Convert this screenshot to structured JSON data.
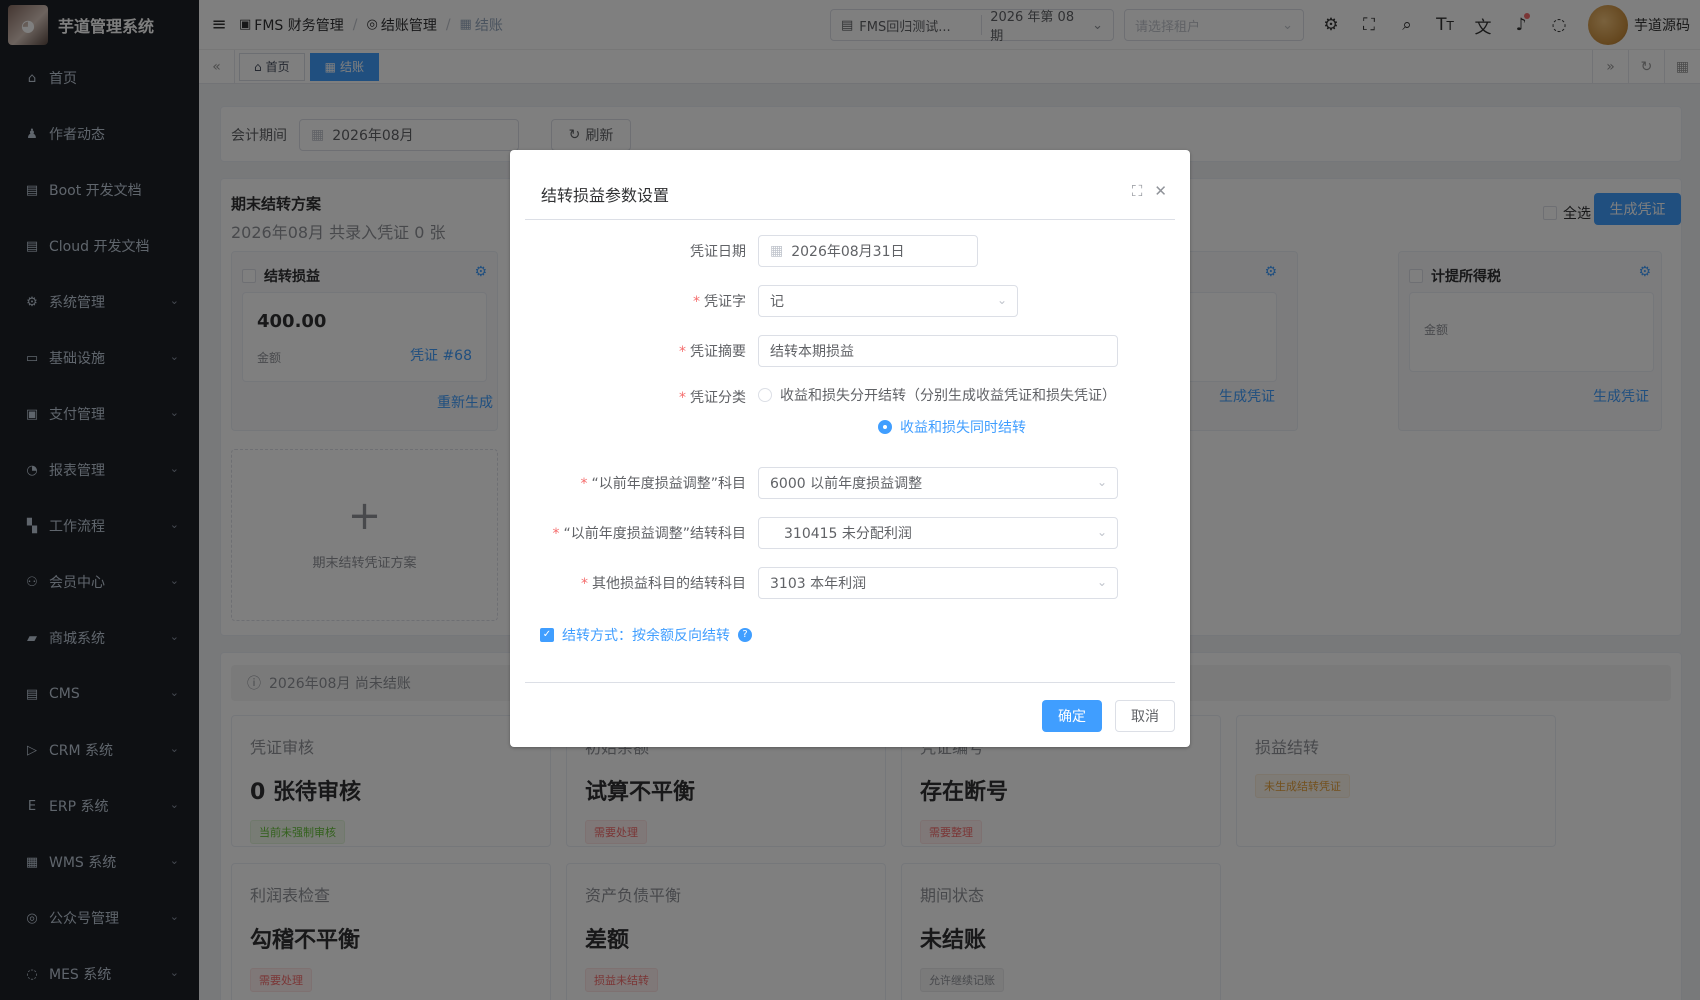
{
  "app": {
    "title": "芋道管理系统"
  },
  "sidebar": {
    "items": [
      {
        "label": "首页",
        "icon": "home-icon",
        "has_children": false
      },
      {
        "label": "作者动态",
        "icon": "user-icon",
        "has_children": false
      },
      {
        "label": "Boot 开发文档",
        "icon": "doc-icon",
        "has_children": false
      },
      {
        "label": "Cloud 开发文档",
        "icon": "doc-icon",
        "has_children": false
      },
      {
        "label": "系统管理",
        "icon": "gear-icon",
        "has_children": true
      },
      {
        "label": "基础设施",
        "icon": "monitor-icon",
        "has_children": true
      },
      {
        "label": "支付管理",
        "icon": "pay-icon",
        "has_children": true
      },
      {
        "label": "报表管理",
        "icon": "chart-icon",
        "has_children": true
      },
      {
        "label": "工作流程",
        "icon": "flow-icon",
        "has_children": true
      },
      {
        "label": "会员中心",
        "icon": "member-icon",
        "has_children": true
      },
      {
        "label": "商城系统",
        "icon": "shop-icon",
        "has_children": true
      },
      {
        "label": "CMS",
        "icon": "cms-icon",
        "has_children": true
      },
      {
        "label": "CRM 系统",
        "icon": "crm-icon",
        "has_children": true
      },
      {
        "label": "ERP 系统",
        "icon": "erp-icon",
        "has_children": true
      },
      {
        "label": "WMS 系统",
        "icon": "wms-icon",
        "has_children": true
      },
      {
        "label": "公众号管理",
        "icon": "wechat-icon",
        "has_children": true
      },
      {
        "label": "MES 系统",
        "icon": "mes-icon",
        "has_children": true
      }
    ]
  },
  "header": {
    "breadcrumb": [
      "FMS 财务管理",
      "结账管理",
      "结账"
    ],
    "ledger_select": "FMS回归测试...",
    "period_select": "2026 年第 08 期",
    "tenant_placeholder": "请选择租户",
    "username": "芋道源码"
  },
  "tags": [
    {
      "label": "首页",
      "active": false
    },
    {
      "label": "结账",
      "active": true
    }
  ],
  "filter": {
    "period_label": "会计期间",
    "period_value": "2026年08月",
    "refresh_label": "刷新"
  },
  "plan": {
    "title": "期末结转方案",
    "subtitle": "2026年08月 共录入凭证 0 张",
    "select_all": "全选",
    "generate": "生成凭证",
    "cards": [
      {
        "title": "结转损益",
        "amount": "400.00",
        "amount_label": "金额",
        "voucher": "凭证 #68",
        "action": "重新生成"
      },
      {
        "title": "计提所得税",
        "amount": "",
        "amount_label": "金额",
        "voucher": "",
        "action": "生成凭证"
      }
    ],
    "hidden_card_action": "生成凭证",
    "add_label": "期末结转凭证方案"
  },
  "status": {
    "banner": "2026年08月 尚未结账",
    "checks": [
      {
        "label": "凭证审核",
        "value": "0 张待审核",
        "tag": "当前未强制审核",
        "tag_color": "green"
      },
      {
        "label": "初始余额",
        "value": "试算不平衡",
        "tag": "需要处理",
        "tag_color": "red"
      },
      {
        "label": "凭证编号",
        "value": "存在断号",
        "tag": "需要整理",
        "tag_color": "red"
      },
      {
        "label": "损益结转",
        "value": "",
        "tag": "未生成结转凭证",
        "tag_color": "orange"
      },
      {
        "label": "利润表检查",
        "value": "勾稽不平衡",
        "tag": "需要处理",
        "tag_color": "red"
      },
      {
        "label": "资产负债平衡",
        "value": "差额",
        "tag": "损益未结转",
        "tag_color": "red"
      },
      {
        "label": "期间状态",
        "value": "未结账",
        "tag": "允许继续记账",
        "tag_color": "gray"
      }
    ]
  },
  "dialog": {
    "title": "结转损益参数设置",
    "fields": {
      "date_label": "凭证日期",
      "date_value": "2026年08月31日",
      "word_label": "凭证字",
      "word_value": "记",
      "summary_label": "凭证摘要",
      "summary_value": "结转本期损益",
      "category_label": "凭证分类",
      "category_option1": "收益和损失分开结转（分别生成收益凭证和损失凭证）",
      "category_option2": "收益和损失同时结转",
      "prev_year_label": "“以前年度损益调整”科目",
      "prev_year_value": "6000 以前年度损益调整",
      "prev_year_target_label": "“以前年度损益调整”结转科目",
      "prev_year_target_value": "310415 未分配利润",
      "other_label": "其他损益科目的结转科目",
      "other_value": "3103 本年利润",
      "method_label": "结转方式：按余额反向结转"
    },
    "confirm": "确定",
    "cancel": "取消"
  }
}
